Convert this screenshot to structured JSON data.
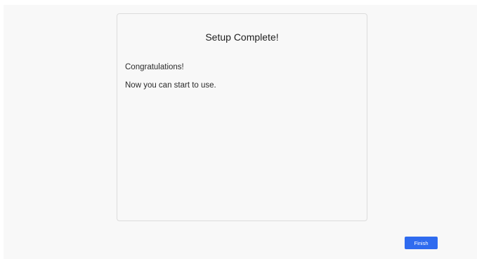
{
  "card": {
    "title": "Setup Complete!",
    "line1": "Congratulations!",
    "line2": "Now you can start to use."
  },
  "footer": {
    "finish_label": "Finish"
  },
  "colors": {
    "accent": "#2f6bef",
    "background": "#f8f8f8",
    "border": "#dcdcdc"
  }
}
